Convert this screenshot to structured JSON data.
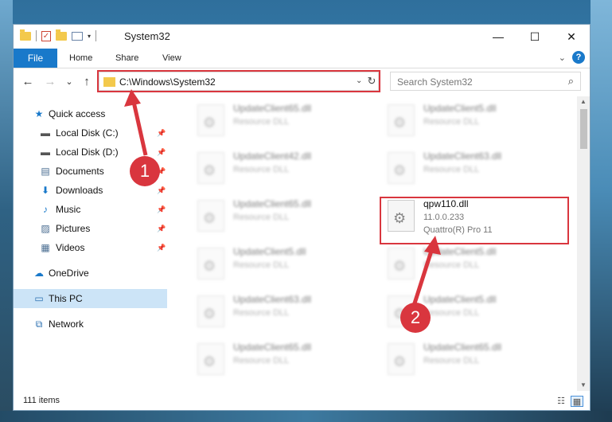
{
  "window": {
    "title": "System32",
    "controls": {
      "minimize": "—",
      "maximize": "☐",
      "close": "✕"
    }
  },
  "ribbon": {
    "tabs": [
      "File",
      "Home",
      "Share",
      "View"
    ],
    "expand_icon": "chevron-down-icon",
    "help_icon": "?"
  },
  "nav": {
    "back": "←",
    "forward": "→",
    "recent": "⌄",
    "up": "↑",
    "address": "C:\\Windows\\System32",
    "refresh": "↻",
    "search_placeholder": "Search System32",
    "search_icon": "⌕"
  },
  "sidebar": {
    "items": [
      {
        "label": "Quick access",
        "icon": "star-icon",
        "glyph": "★",
        "pinned": false
      },
      {
        "label": "Local Disk (C:)",
        "icon": "drive-icon",
        "glyph": "▬",
        "pinned": true
      },
      {
        "label": "Local Disk (D:)",
        "icon": "drive-icon",
        "glyph": "▬",
        "pinned": true
      },
      {
        "label": "Documents",
        "icon": "documents-icon",
        "glyph": "▤",
        "pinned": true
      },
      {
        "label": "Downloads",
        "icon": "downloads-icon",
        "glyph": "⬇",
        "pinned": true
      },
      {
        "label": "Music",
        "icon": "music-icon",
        "glyph": "♪",
        "pinned": true
      },
      {
        "label": "Pictures",
        "icon": "pictures-icon",
        "glyph": "▨",
        "pinned": true
      },
      {
        "label": "Videos",
        "icon": "videos-icon",
        "glyph": "▦",
        "pinned": true
      },
      {
        "label": "OneDrive",
        "icon": "cloud-icon",
        "glyph": "☁",
        "pinned": false
      },
      {
        "label": "This PC",
        "icon": "computer-icon",
        "glyph": "▭",
        "pinned": false,
        "selected": true
      },
      {
        "label": "Network",
        "icon": "network-icon",
        "glyph": "⧉",
        "pinned": false
      }
    ]
  },
  "files": {
    "left_column": [
      {
        "name": "UpdateClient65.dll",
        "type": "Resource DLL"
      },
      {
        "name": "UpdateClient42.dll",
        "type": "Resource DLL"
      },
      {
        "name": "UpdateClient65.dll",
        "type": "Resource DLL"
      },
      {
        "name": "UpdateClient5.dll",
        "type": "Resource DLL"
      },
      {
        "name": "UpdateClient63.dll",
        "type": "Resource DLL"
      },
      {
        "name": "UpdateClient65.dll",
        "type": "Resource DLL"
      }
    ],
    "right_column": [
      {
        "name": "UpdateClient5.dll",
        "type": "Resource DLL"
      },
      {
        "name": "UpdateClient63.dll",
        "type": "Resource DLL"
      },
      {
        "name": "UpdateClient5.dll",
        "type": "Resource DLL"
      },
      {
        "name": "UpdateClient5.dll",
        "type": "Resource DLL"
      },
      {
        "name": "UpdateClient65.dll",
        "type": "Resource DLL"
      }
    ],
    "highlighted": {
      "name": "qpw110.dll",
      "version": "11.0.0.233",
      "product": "Quattro(R) Pro 11"
    }
  },
  "annotations": {
    "step1": "1",
    "step2": "2",
    "highlight_color": "#d9363e"
  },
  "status": {
    "item_count": "111 items",
    "view_details_icon": "☷",
    "view_tiles_icon": "▦"
  },
  "colors": {
    "accent": "#1979ca",
    "selection": "#cce4f7",
    "callout": "#d9363e"
  }
}
